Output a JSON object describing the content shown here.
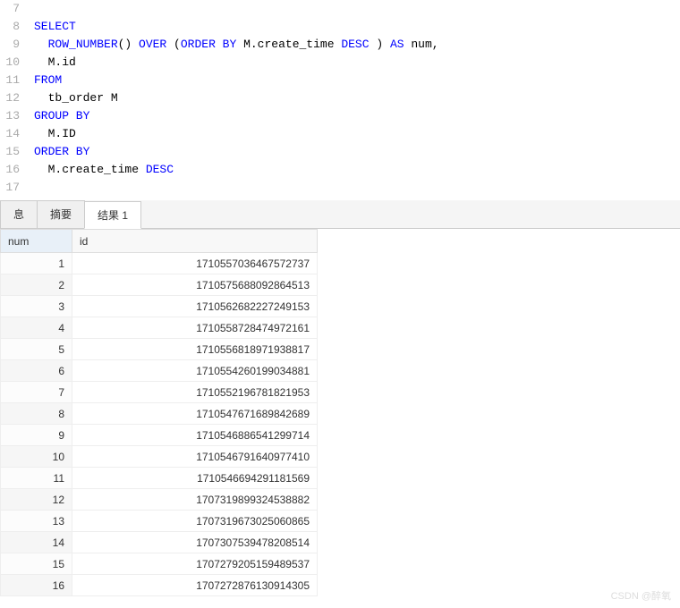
{
  "editor": {
    "lines": [
      {
        "num": 7,
        "tokens": []
      },
      {
        "num": 8,
        "tokens": [
          {
            "t": "SELECT",
            "c": "kw"
          }
        ]
      },
      {
        "num": 9,
        "tokens": [
          {
            "t": "  ",
            "c": ""
          },
          {
            "t": "ROW_NUMBER",
            "c": "kw"
          },
          {
            "t": "() ",
            "c": ""
          },
          {
            "t": "OVER",
            "c": "kw"
          },
          {
            "t": " (",
            "c": ""
          },
          {
            "t": "ORDER BY",
            "c": "kw"
          },
          {
            "t": " M.create_time ",
            "c": ""
          },
          {
            "t": "DESC",
            "c": "kw"
          },
          {
            "t": " ) ",
            "c": ""
          },
          {
            "t": "AS",
            "c": "kw"
          },
          {
            "t": " num,",
            "c": ""
          }
        ]
      },
      {
        "num": 10,
        "tokens": [
          {
            "t": "  M.id",
            "c": ""
          }
        ]
      },
      {
        "num": 11,
        "tokens": [
          {
            "t": "FROM",
            "c": "kw"
          }
        ]
      },
      {
        "num": 12,
        "tokens": [
          {
            "t": "  tb_order M",
            "c": ""
          }
        ]
      },
      {
        "num": 13,
        "tokens": [
          {
            "t": "GROUP BY",
            "c": "kw"
          }
        ]
      },
      {
        "num": 14,
        "tokens": [
          {
            "t": "  M.ID",
            "c": ""
          }
        ]
      },
      {
        "num": 15,
        "tokens": [
          {
            "t": "ORDER BY",
            "c": "kw"
          }
        ]
      },
      {
        "num": 16,
        "tokens": [
          {
            "t": "  M.create_time ",
            "c": ""
          },
          {
            "t": "DESC",
            "c": "kw"
          }
        ]
      },
      {
        "num": 17,
        "tokens": []
      }
    ]
  },
  "tabs": {
    "items": [
      {
        "label": "息",
        "active": false
      },
      {
        "label": "摘要",
        "active": false
      },
      {
        "label": "结果 1",
        "active": true
      }
    ]
  },
  "results": {
    "columns": [
      "num",
      "id"
    ],
    "rows": [
      {
        "num": "1",
        "id": "1710557036467572737"
      },
      {
        "num": "2",
        "id": "1710575688092864513"
      },
      {
        "num": "3",
        "id": "1710562682227249153"
      },
      {
        "num": "4",
        "id": "1710558728474972161"
      },
      {
        "num": "5",
        "id": "1710556818971938817"
      },
      {
        "num": "6",
        "id": "1710554260199034881"
      },
      {
        "num": "7",
        "id": "1710552196781821953"
      },
      {
        "num": "8",
        "id": "1710547671689842689"
      },
      {
        "num": "9",
        "id": "1710546886541299714"
      },
      {
        "num": "10",
        "id": "1710546791640977410"
      },
      {
        "num": "11",
        "id": "1710546694291181569"
      },
      {
        "num": "12",
        "id": "1707319899324538882"
      },
      {
        "num": "13",
        "id": "1707319673025060865"
      },
      {
        "num": "14",
        "id": "1707307539478208514"
      },
      {
        "num": "15",
        "id": "1707279205159489537"
      },
      {
        "num": "16",
        "id": "1707272876130914305"
      }
    ]
  },
  "watermark": "CSDN @醉氧"
}
